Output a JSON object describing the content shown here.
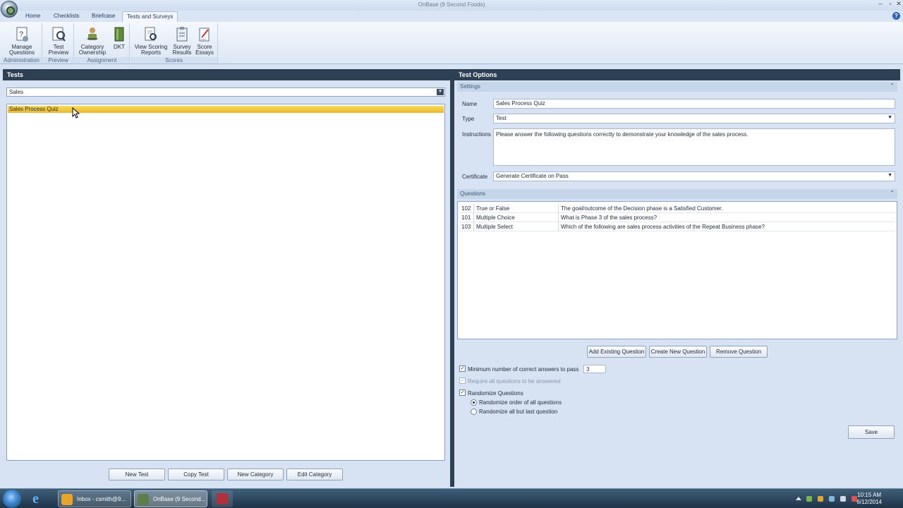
{
  "window": {
    "title": "OnBase (9 Second Foods)",
    "minimize": "–",
    "maximize": "▫",
    "close": "✕"
  },
  "tabs": [
    "Home",
    "Checklists",
    "Briefcase",
    "Tests and Surveys"
  ],
  "active_tab": "Tests and Surveys",
  "help_label": "?",
  "ribbon": {
    "groups": [
      {
        "label": "Administration",
        "buttons": [
          {
            "line1": "Manage",
            "line2": "Questions",
            "icon": "manage-questions-icon"
          }
        ]
      },
      {
        "label": "Preview",
        "buttons": [
          {
            "line1": "Test",
            "line2": "Preview",
            "icon": "test-preview-icon"
          }
        ]
      },
      {
        "label": "Assignment",
        "buttons": [
          {
            "line1": "Category",
            "line2": "Ownership",
            "icon": "category-ownership-icon"
          },
          {
            "line1": "DKT",
            "line2": "",
            "icon": "dkt-icon"
          }
        ]
      },
      {
        "label": "Scores",
        "buttons": [
          {
            "line1": "View Scoring",
            "line2": "Reports",
            "icon": "scoring-reports-icon"
          },
          {
            "line1": "Survey",
            "line2": "Results",
            "icon": "survey-results-icon"
          },
          {
            "line1": "Score",
            "line2": "Essays",
            "icon": "score-essays-icon"
          }
        ]
      }
    ]
  },
  "tests_panel": {
    "title": "Tests",
    "category": "Sales",
    "tests": [
      "Sales Process Quiz"
    ],
    "selected_test": "Sales Process Quiz",
    "buttons": {
      "new_test": "New Test",
      "copy_test": "Copy Test",
      "new_category": "New Category",
      "edit_category": "Edit Category"
    }
  },
  "options_panel": {
    "title": "Test Options",
    "settings": {
      "section_label": "Settings",
      "name_label": "Name",
      "name_value": "Sales Process Quiz",
      "type_label": "Type",
      "type_value": "Test",
      "instructions_label": "Instructions",
      "instructions_value": "Please answer the following questions correctly to demonstrate your knowledge of the sales process.",
      "certificate_label": "Certificate",
      "certificate_value": "Generate Certificate on Pass"
    },
    "questions": {
      "section_label": "Questions",
      "rows": [
        {
          "id": "102",
          "type": "True or False",
          "text": "The goal/outcome of the Decision phase is a Satisfied Customer."
        },
        {
          "id": "101",
          "type": "Multiple Choice",
          "text": "What is Phase 3 of the sales process?"
        },
        {
          "id": "103",
          "type": "Multiple Select",
          "text": "Which of the following are sales process activities of the Repeat Business phase?"
        }
      ],
      "buttons": {
        "add_existing": "Add Existing Question",
        "create_new": "Create New Question",
        "remove": "Remove Question"
      }
    },
    "options": {
      "min_correct_label": "Minimum number of correct answers to pass",
      "min_correct_checked": true,
      "min_correct_value": "3",
      "require_all_label": "Require all questions to be answered",
      "require_all_checked": true,
      "randomize_label": "Randomize Questions",
      "randomize_checked": true,
      "randomize_all_label": "Randomize order of all questions",
      "randomize_but_last_label": "Randomize all but last question",
      "randomize_mode": "all"
    },
    "save_label": "Save"
  },
  "taskbar": {
    "items": [
      {
        "label": "Inbox - csmith@9...",
        "icon": "outlook-icon",
        "color": "#e9a52a"
      },
      {
        "label": "OnBase (9 Second...",
        "icon": "onbase-icon",
        "color": "#5b7f4a"
      }
    ],
    "clock_time": "10:15 AM",
    "clock_date": "6/12/2014"
  },
  "colors": {
    "accent": "#2e4054",
    "selection": "#f1c842",
    "background": "#d7e3f2"
  }
}
